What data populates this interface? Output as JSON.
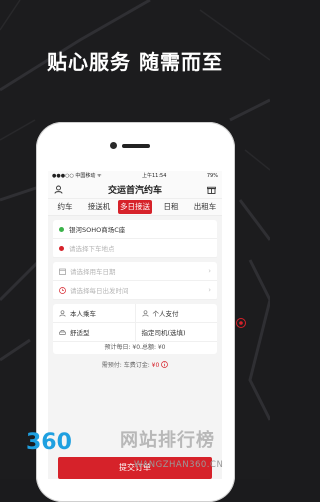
{
  "headline": "贴心服务  随需而至",
  "status_bar": {
    "carrier": "●●●○○ 中国移动 ᯤ",
    "time": "上午11:54",
    "battery": "79%"
  },
  "app": {
    "title": "交运首汽约车"
  },
  "tabs": [
    "约车",
    "接送机",
    "多日接送",
    "日租",
    "出租车"
  ],
  "active_tab": "多日接送",
  "locations": {
    "from": "银河SOHO商场C座",
    "to_placeholder": "请选择下车地点"
  },
  "schedule": {
    "date_placeholder": "请选择用车日期",
    "time_placeholder": "请选择每日出发时间"
  },
  "options": {
    "passenger": "本人乘车",
    "payment": "个人支付",
    "car_type": "舒适型",
    "driver": "指定司机(选填)"
  },
  "estimate": "预计每日: ¥0.总额: ¥0",
  "prepay": {
    "label": "需预付: 车费订金: ",
    "amount": "¥0"
  },
  "submit_label": "提交订单",
  "watermark": {
    "logo": "360",
    "text": "网站排行榜",
    "url": "WANGZHAN360.CN"
  },
  "colors": {
    "accent": "#d6222a",
    "background": "#1b1b1d"
  }
}
